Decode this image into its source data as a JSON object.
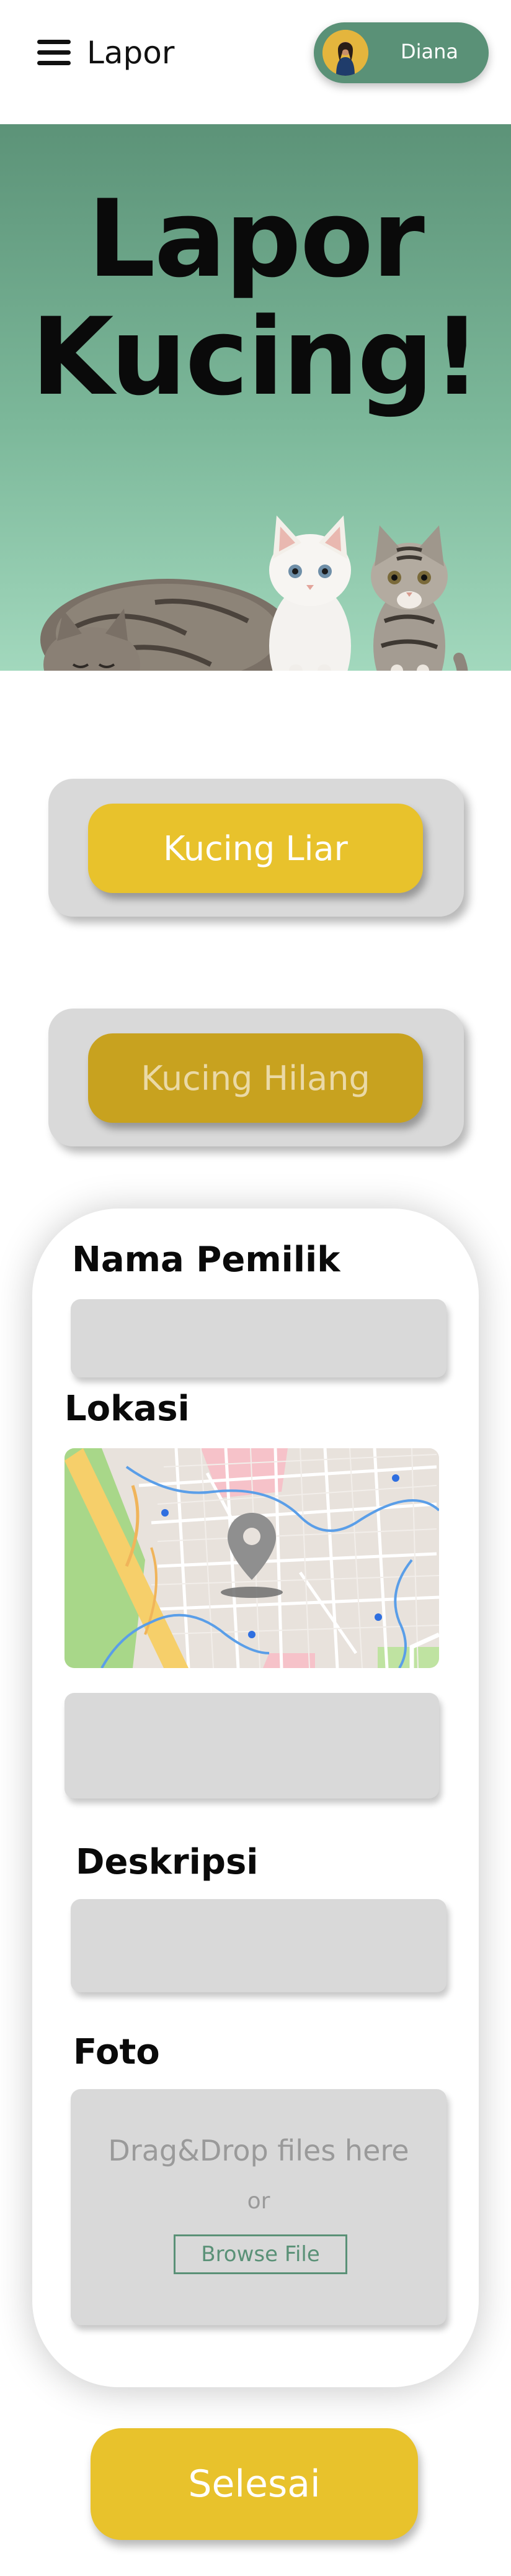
{
  "header": {
    "menu_icon": "hamburger-menu-icon",
    "title": "Lapor",
    "profile": {
      "name": "Diana",
      "avatar_icon": "user-avatar"
    }
  },
  "hero": {
    "title_line1": "Lapor",
    "title_line2": "Kucing!",
    "image": "cats-illustration"
  },
  "categories": {
    "stray": "Kucing Liar",
    "lost": "Kucing Hilang"
  },
  "form": {
    "owner_label": "Nama Pemilik",
    "owner_value": "",
    "location_label": "Lokasi",
    "location_value": "",
    "map_icon": "map-pin-icon",
    "description_label": "Deskripsi",
    "description_value": "",
    "photo_label": "Foto",
    "dropzone_text": "Drag&Drop files here",
    "dropzone_or": "or",
    "browse_label": "Browse File"
  },
  "submit_label": "Selesai",
  "colors": {
    "primary_green": "#5a9177",
    "accent_yellow": "#e8c22c",
    "dark_yellow": "#c8a21f",
    "field_gray": "#d9d9d9"
  }
}
